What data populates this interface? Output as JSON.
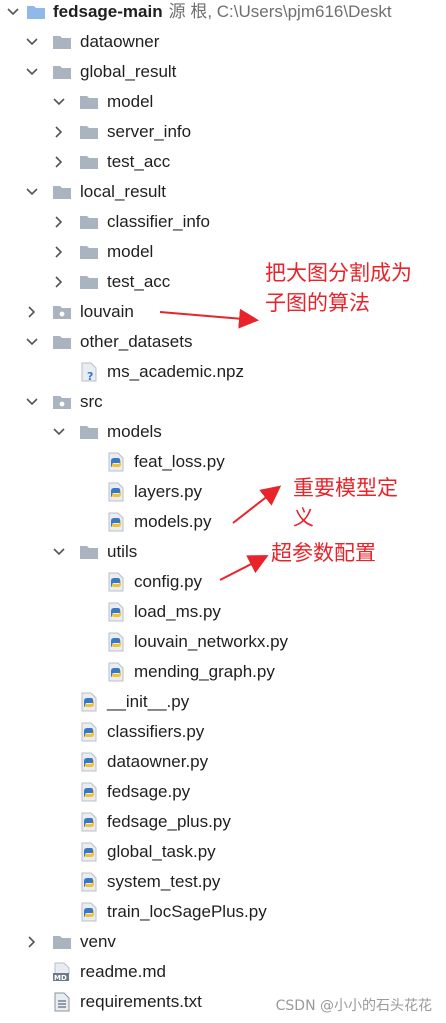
{
  "root": {
    "name": "fedsage-main",
    "path_hint": "源 根, C:\\Users\\pjm616\\Deskt"
  },
  "tree": [
    {
      "label": "dataowner",
      "type": "folder",
      "depth": 1,
      "state": "expanded"
    },
    {
      "label": "global_result",
      "type": "folder",
      "depth": 1,
      "state": "expanded"
    },
    {
      "label": "model",
      "type": "folder",
      "depth": 2,
      "state": "expanded"
    },
    {
      "label": "server_info",
      "type": "folder",
      "depth": 2,
      "state": "collapsed"
    },
    {
      "label": "test_acc",
      "type": "folder",
      "depth": 2,
      "state": "collapsed"
    },
    {
      "label": "local_result",
      "type": "folder",
      "depth": 1,
      "state": "expanded"
    },
    {
      "label": "classifier_info",
      "type": "folder",
      "depth": 2,
      "state": "collapsed"
    },
    {
      "label": "model",
      "type": "folder",
      "depth": 2,
      "state": "collapsed"
    },
    {
      "label": "test_acc",
      "type": "folder",
      "depth": 2,
      "state": "collapsed"
    },
    {
      "label": "louvain",
      "type": "package",
      "depth": 1,
      "state": "collapsed"
    },
    {
      "label": "other_datasets",
      "type": "folder",
      "depth": 1,
      "state": "expanded"
    },
    {
      "label": "ms_academic.npz",
      "type": "unknown-file",
      "depth": 2,
      "state": "none"
    },
    {
      "label": "src",
      "type": "package",
      "depth": 1,
      "state": "expanded"
    },
    {
      "label": "models",
      "type": "folder",
      "depth": 2,
      "state": "expanded"
    },
    {
      "label": "feat_loss.py",
      "type": "python",
      "depth": 3,
      "state": "none"
    },
    {
      "label": "layers.py",
      "type": "python",
      "depth": 3,
      "state": "none"
    },
    {
      "label": "models.py",
      "type": "python",
      "depth": 3,
      "state": "none"
    },
    {
      "label": "utils",
      "type": "folder",
      "depth": 2,
      "state": "expanded"
    },
    {
      "label": "config.py",
      "type": "python",
      "depth": 3,
      "state": "none"
    },
    {
      "label": "load_ms.py",
      "type": "python",
      "depth": 3,
      "state": "none"
    },
    {
      "label": "louvain_networkx.py",
      "type": "python",
      "depth": 3,
      "state": "none"
    },
    {
      "label": "mending_graph.py",
      "type": "python",
      "depth": 3,
      "state": "none"
    },
    {
      "label": "__init__.py",
      "type": "python",
      "depth": 2,
      "state": "none"
    },
    {
      "label": "classifiers.py",
      "type": "python",
      "depth": 2,
      "state": "none"
    },
    {
      "label": "dataowner.py",
      "type": "python",
      "depth": 2,
      "state": "none"
    },
    {
      "label": "fedsage.py",
      "type": "python",
      "depth": 2,
      "state": "none"
    },
    {
      "label": "fedsage_plus.py",
      "type": "python",
      "depth": 2,
      "state": "none"
    },
    {
      "label": "global_task.py",
      "type": "python",
      "depth": 2,
      "state": "none"
    },
    {
      "label": "system_test.py",
      "type": "python",
      "depth": 2,
      "state": "none"
    },
    {
      "label": "train_locSagePlus.py",
      "type": "python",
      "depth": 2,
      "state": "none"
    },
    {
      "label": "venv",
      "type": "folder",
      "depth": 1,
      "state": "collapsed"
    },
    {
      "label": "readme.md",
      "type": "markdown",
      "depth": 1,
      "state": "none"
    },
    {
      "label": "requirements.txt",
      "type": "text",
      "depth": 1,
      "state": "none"
    }
  ],
  "annotations": {
    "louvain_line1": "把大图分割成为",
    "louvain_line2": "子图的算法",
    "models_line1": "重要模型定",
    "models_line2": "义",
    "config": "超参数配置"
  },
  "watermark": "CSDN @小小的石头花花",
  "icons": {
    "md_badge": "MD",
    "unknown_badge": "?"
  },
  "colors": {
    "folder": "#a9b4c0",
    "root_folder": "#8fb9e8",
    "annotation": "#e8232a",
    "python_blue": "#3a78c2",
    "python_yellow": "#f2c233"
  }
}
